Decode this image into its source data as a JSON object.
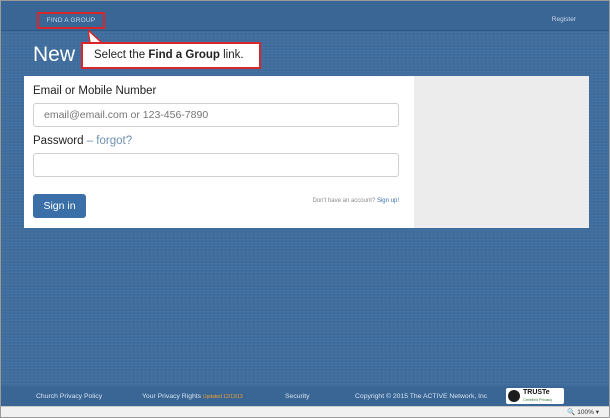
{
  "topbar": {
    "find_group_label": "FIND A GROUP",
    "register_label": "Register"
  },
  "page": {
    "heading": "New L"
  },
  "callout": {
    "prefix": "Select the ",
    "bold": "Find a Group",
    "suffix": " link."
  },
  "login": {
    "email_label": "Email or Mobile Number",
    "email_placeholder": "email@email.com or 123-456-7890",
    "password_label": "Password",
    "forgot_text": " – forgot?",
    "password_value": "",
    "signin_label": "Sign in",
    "no_account_text": "Don't have an account? ",
    "signup_link": "Sign up!"
  },
  "footer": {
    "privacy_policy": "Church Privacy Policy",
    "privacy_rights": "Your Privacy Rights",
    "updated_note": "Updated 12/13/13",
    "security": "Security",
    "copyright": "Copyright © 2015 The ACTIVE Network, Inc",
    "truste_title": "TRUSTe",
    "truste_sub": "Certified Privacy"
  },
  "statusbar": {
    "zoom_level": "100%",
    "zoom_arrow": "▾"
  },
  "colors": {
    "background": "#3f6d9e",
    "highlight": "#d9262a",
    "button": "#3a6fa8"
  }
}
